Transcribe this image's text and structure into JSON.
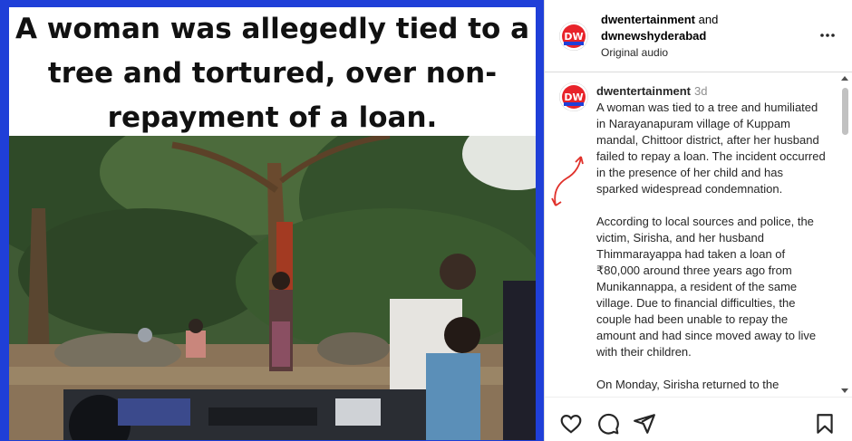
{
  "post": {
    "headline": "A woman was allegedly tied to a tree and tortured, over non-repayment of a loan."
  },
  "header": {
    "author_primary": "dwentertainment",
    "joiner": " and",
    "author_secondary": "dwnewshyderabad",
    "audio": "Original audio",
    "more_icon": "more-horizontal-icon"
  },
  "caption": {
    "username": "dwentertainment",
    "time": "3d",
    "paragraph1": "A woman was tied to a tree and humiliated in Narayanapuram village of Kuppam mandal, Chittoor district, after her husband failed to repay a loan. The incident occurred in the presence of her child and has sparked widespread condemnation.",
    "paragraph2": "According to local sources and police, the victim, Sirisha, and her husband Thimmarayappa had taken a loan of ₹80,000 around three years ago from Munikannappa, a resident of the same village. Due to financial difficulties, the couple had been unable to repay the amount and had since moved away to live with their children.",
    "paragraph3": "On Monday, Sirisha returned to the"
  },
  "avatar_logo": "DW",
  "actions": [
    "heart-icon",
    "comment-icon",
    "share-icon",
    "bookmark-icon"
  ],
  "colors": {
    "frame_blue": "#1f3fd8",
    "annotation_red": "#e0312b"
  }
}
